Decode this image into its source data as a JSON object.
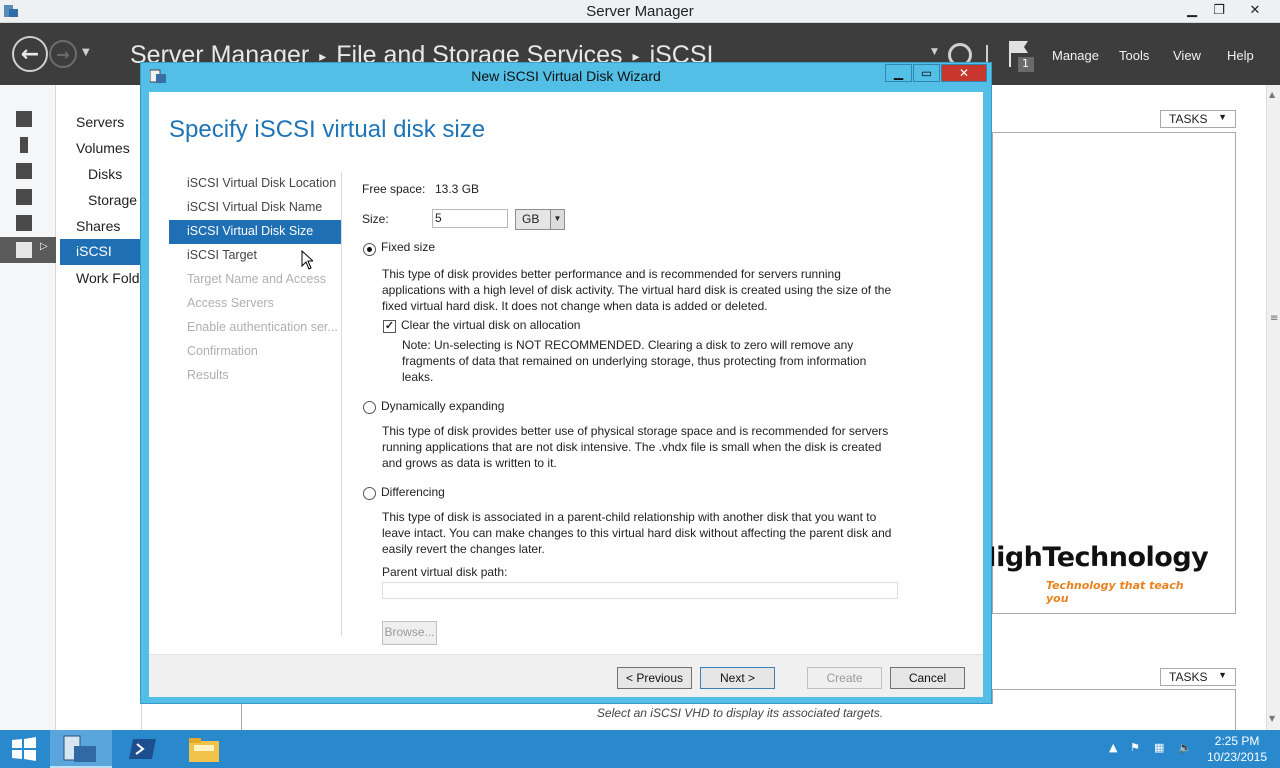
{
  "window": {
    "title": "Server Manager",
    "controls": {
      "minimize": "▁",
      "restore": "❐",
      "close": "✕"
    }
  },
  "header": {
    "breadcrumb": [
      "Server Manager",
      "File and Storage Services",
      "iSCSI"
    ],
    "flag_badge": "1",
    "menu": [
      "Manage",
      "Tools",
      "View",
      "Help"
    ]
  },
  "nav": {
    "items": [
      "Servers",
      "Volumes",
      "Disks",
      "Storage",
      "Shares",
      "iSCSI",
      "Work Fold"
    ]
  },
  "content": {
    "tasks_label": "TASKS",
    "hint": "Select an iSCSI VHD to display its associated targets."
  },
  "wizard": {
    "title": "New iSCSI Virtual Disk Wizard",
    "page_title": "Specify iSCSI virtual disk size",
    "steps": [
      {
        "label": "iSCSI Virtual Disk Location",
        "state": "normal"
      },
      {
        "label": "iSCSI Virtual Disk Name",
        "state": "normal"
      },
      {
        "label": "iSCSI Virtual Disk Size",
        "state": "active"
      },
      {
        "label": "iSCSI Target",
        "state": "normal"
      },
      {
        "label": "Target Name and Access",
        "state": "disabled"
      },
      {
        "label": "Access Servers",
        "state": "disabled"
      },
      {
        "label": "Enable authentication ser...",
        "state": "disabled"
      },
      {
        "label": "Confirmation",
        "state": "disabled"
      },
      {
        "label": "Results",
        "state": "disabled"
      }
    ],
    "free_space_label": "Free space:",
    "free_space_value": "13.3 GB",
    "size_label": "Size:",
    "size_value": "5",
    "unit_value": "GB",
    "fixed": {
      "label": "Fixed size",
      "selected": true,
      "desc": "This type of disk provides better performance and is recommended for servers running applications with a high level of disk activity. The virtual hard disk is created using the size of the fixed virtual hard disk. It does not change when data is added or deleted.",
      "clear_label": "Clear the virtual disk on allocation",
      "clear_checked": true,
      "note": "Note: Un-selecting is NOT RECOMMENDED. Clearing a disk to zero will remove any fragments of data that remained on underlying storage, thus protecting from information leaks."
    },
    "dynamic": {
      "label": "Dynamically expanding",
      "desc": "This type of disk provides better use of physical storage space and is recommended for servers running applications that are not disk intensive. The .vhdx file is small when the disk is created and grows as data is written to it."
    },
    "differencing": {
      "label": "Differencing",
      "desc": "This type of disk is associated in a parent-child relationship with another disk that you want to leave intact. You can make changes to this virtual hard disk without affecting the parent disk and easily revert the changes later.",
      "path_label": "Parent virtual disk path:",
      "path_value": "",
      "browse_label": "Browse..."
    },
    "buttons": {
      "previous": "< Previous",
      "next": "Next >",
      "create": "Create",
      "cancel": "Cancel"
    }
  },
  "watermark": {
    "brand": "HighTechnology",
    "tagline": "Technology that teach you"
  },
  "taskbar": {
    "time": "2:25 PM",
    "date": "10/23/2015"
  },
  "colors": {
    "accent": "#1f6fb5",
    "wizard_frame": "#54bfe6",
    "header_bg": "#3d3d3d",
    "taskbar": "#2a89cd"
  }
}
